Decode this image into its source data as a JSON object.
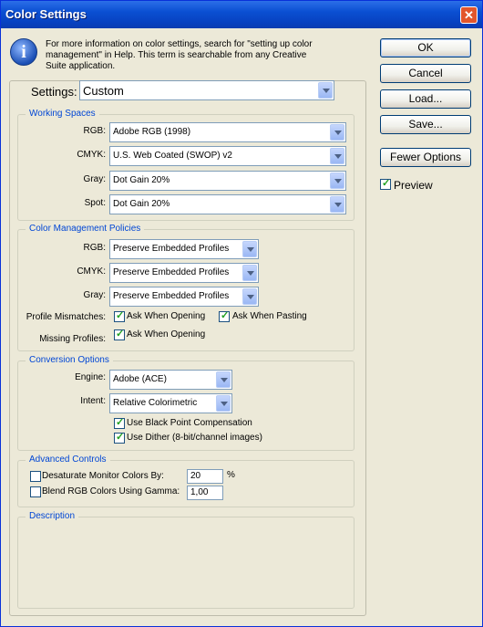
{
  "window": {
    "title": "Color Settings",
    "close_glyph": "✕"
  },
  "info": {
    "icon": "info-icon",
    "glyph": "i",
    "text": "For more information on color settings, search for \"setting up color management\" in Help. This term is searchable from any Creative Suite application."
  },
  "buttons": {
    "ok": "OK",
    "cancel": "Cancel",
    "load": "Load...",
    "save": "Save...",
    "fewer_options": "Fewer Options"
  },
  "preview": {
    "label": "Preview",
    "checked": true
  },
  "settings": {
    "label": "Settings:",
    "value": "Custom"
  },
  "working_spaces": {
    "title": "Working Spaces",
    "rows": [
      {
        "label": "RGB:",
        "value": "Adobe RGB (1998)"
      },
      {
        "label": "CMYK:",
        "value": "U.S. Web Coated (SWOP) v2"
      },
      {
        "label": "Gray:",
        "value": "Dot Gain 20%"
      },
      {
        "label": "Spot:",
        "value": "Dot Gain 20%"
      }
    ]
  },
  "policies": {
    "title": "Color Management Policies",
    "rows": [
      {
        "label": "RGB:",
        "value": "Preserve Embedded Profiles"
      },
      {
        "label": "CMYK:",
        "value": "Preserve Embedded Profiles"
      },
      {
        "label": "Gray:",
        "value": "Preserve Embedded Profiles"
      }
    ],
    "profile_mismatches": {
      "label": "Profile Mismatches:",
      "ask_opening": "Ask When Opening",
      "ask_pasting": "Ask When Pasting"
    },
    "missing_profiles": {
      "label": "Missing Profiles:",
      "ask_opening": "Ask When Opening"
    }
  },
  "conversion": {
    "title": "Conversion Options",
    "engine": {
      "label": "Engine:",
      "value": "Adobe (ACE)"
    },
    "intent": {
      "label": "Intent:",
      "value": "Relative Colorimetric"
    },
    "black_point": "Use Black Point Compensation",
    "dither": "Use Dither (8-bit/channel images)"
  },
  "advanced": {
    "title": "Advanced Controls",
    "desaturate": {
      "label": "Desaturate Monitor Colors By:",
      "value": "20",
      "unit": "%"
    },
    "blend": {
      "label": "Blend RGB Colors Using Gamma:",
      "value": "1,00"
    }
  },
  "description": {
    "title": "Description"
  }
}
